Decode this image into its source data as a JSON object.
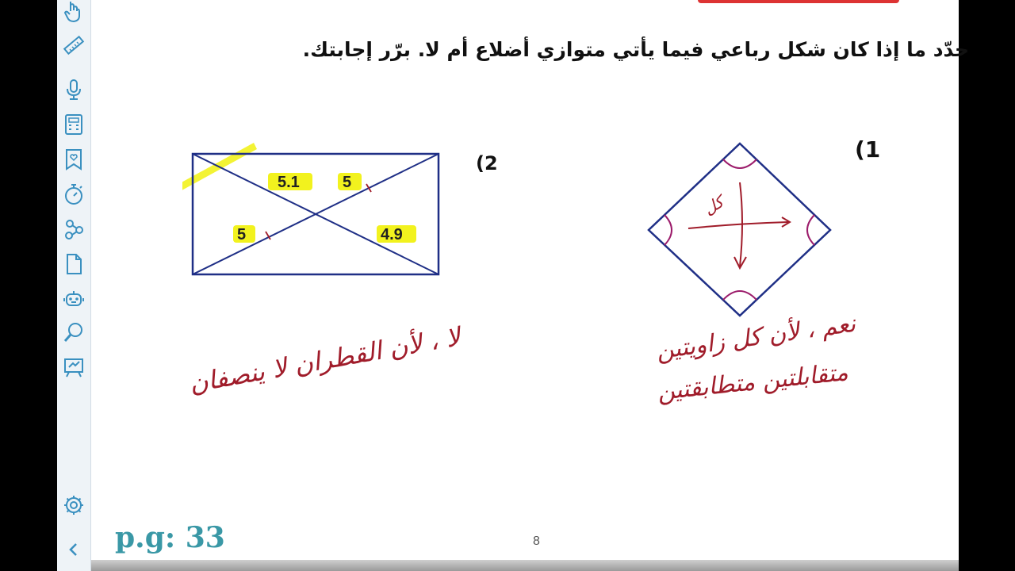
{
  "instruction": "حدّد ما إذا كان شكل رباعي فيما يأتي متوازي أضلاع أم لا. برّر إجابتك.",
  "questions": [
    {
      "number": "(1",
      "answer": [
        "نعم ، لأن كل زاويتين",
        "متقابلتين متطابقتين"
      ],
      "arrow_label": "كل"
    },
    {
      "number": "(2",
      "answer": [
        "لا ، لأن القطران لا ينصفان"
      ],
      "segments": [
        "5.1",
        "5",
        "5",
        "4.9"
      ]
    }
  ],
  "page_code": "p.g: 33",
  "page_number": "8",
  "sidebar_tools": [
    "hand-pointer-icon",
    "ruler-icon",
    "microphone-icon",
    "calculator-icon",
    "bookmark-heart-icon",
    "timer-icon",
    "share-nodes-icon",
    "document-icon",
    "robot-icon",
    "search-icon",
    "whiteboard-icon",
    "settings-icon",
    "collapse-chevron-icon"
  ],
  "colors": {
    "shape": "#1f2f86",
    "highlight": "#f2f21e",
    "handwriting": "#a01c2a",
    "angle_marks": "#9c1c6b",
    "page_code": "#3a98a6"
  }
}
